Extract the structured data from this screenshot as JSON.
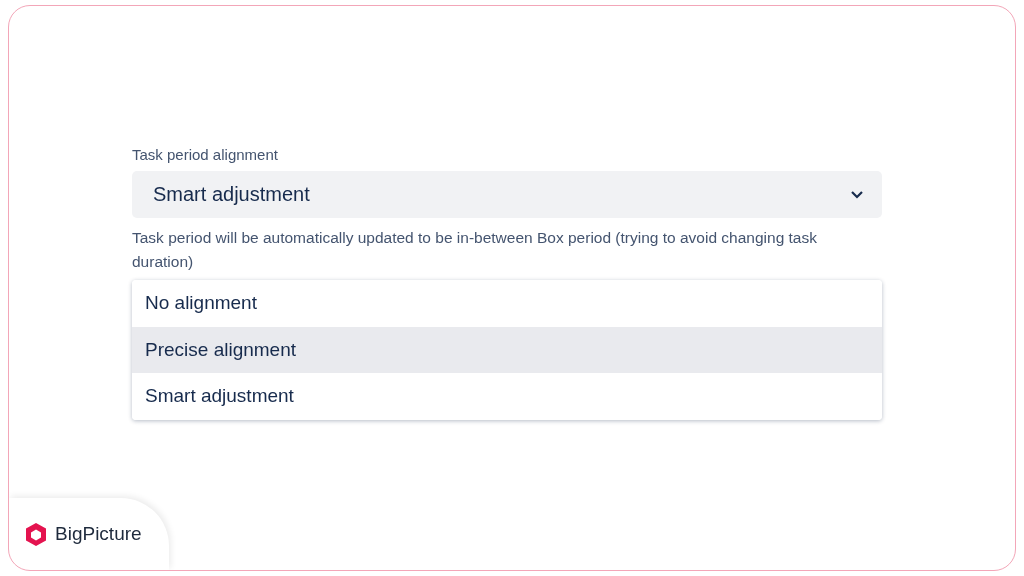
{
  "field": {
    "label": "Task period alignment",
    "value": "Smart adjustment",
    "help": "Task period will be automatically updated to be in-between Box period (trying to avoid changing task duration)"
  },
  "options": [
    {
      "label": "No alignment",
      "highlighted": false
    },
    {
      "label": "Precise alignment",
      "highlighted": true
    },
    {
      "label": "Smart adjustment",
      "highlighted": false
    }
  ],
  "brand": {
    "name": "BigPicture"
  }
}
